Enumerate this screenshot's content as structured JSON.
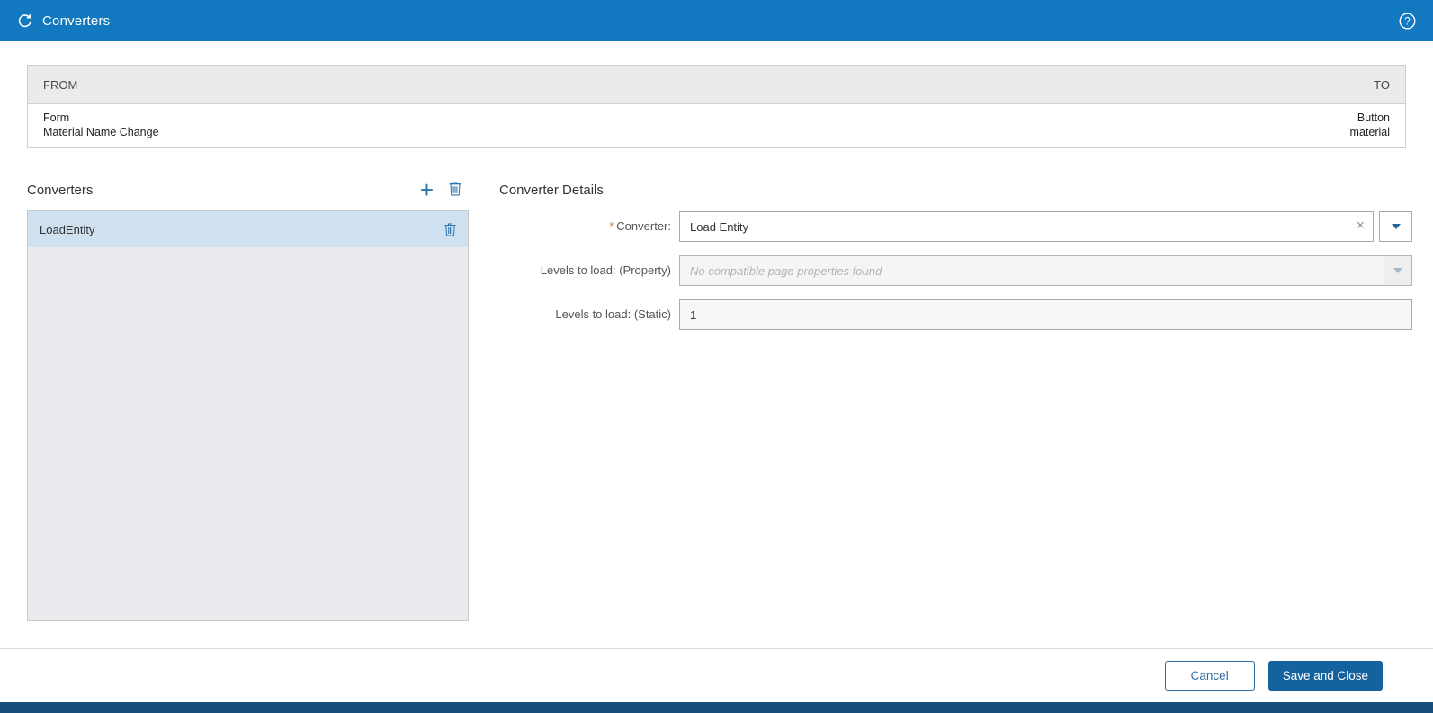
{
  "header": {
    "title": "Converters"
  },
  "mapping": {
    "from_header": "FROM",
    "to_header": "TO",
    "from_line1": "Form",
    "from_line2": "Material Name Change",
    "to_line1": "Button",
    "to_line2": "material"
  },
  "converters": {
    "title": "Converters",
    "items": [
      {
        "label": "LoadEntity",
        "selected": true
      }
    ]
  },
  "details": {
    "title": "Converter Details",
    "converter": {
      "required_marker": "*",
      "label": "Converter:",
      "value": "Load Entity"
    },
    "levels_property": {
      "label": "Levels to load: (Property)",
      "placeholder": "No compatible page properties found",
      "disabled": true
    },
    "levels_static": {
      "label": "Levels to load: (Static)",
      "value": "1"
    }
  },
  "footer": {
    "cancel": "Cancel",
    "save": "Save and Close"
  },
  "icons": {
    "add": "+",
    "clear": "×",
    "help": "?"
  },
  "colors": {
    "header_bg": "#1278bf",
    "accent": "#2a75ad",
    "selected_item_bg": "#cfe0f0",
    "save_button_bg": "#15639e",
    "bottom_bar": "#174f7c",
    "required_marker": "#d9822b"
  }
}
